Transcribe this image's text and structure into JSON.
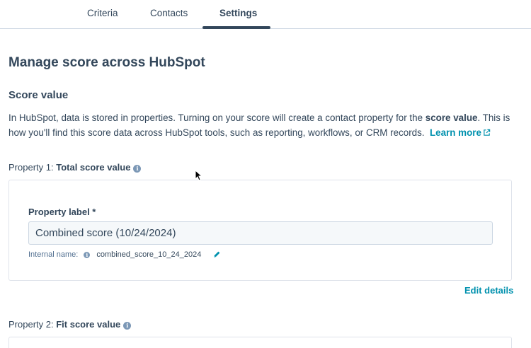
{
  "tabs": [
    {
      "label": "Criteria",
      "active": false
    },
    {
      "label": "Contacts",
      "active": false
    },
    {
      "label": "Settings",
      "active": true
    }
  ],
  "page_title": "Manage score across HubSpot",
  "section": {
    "title": "Score value",
    "description_1": "In HubSpot, data is stored in properties. Turning on your score will create a contact property for the ",
    "description_bold": "score value",
    "description_2": ". This is how you'll find this score data across HubSpot tools, such as reporting, workflows, or CRM records.",
    "learn_more": "Learn more"
  },
  "property1": {
    "prefix": "Property 1:",
    "name": "Total score value",
    "field_label": "Property label *",
    "field_value": "Combined score (10/24/2024)",
    "internal_label": "Internal name:",
    "internal_value": "combined_score_10_24_2024",
    "edit_details": "Edit details"
  },
  "property2": {
    "prefix": "Property 2:",
    "name": "Fit score value"
  },
  "icons": {
    "info": "info-icon",
    "external": "external-link-icon",
    "edit": "pencil-icon"
  },
  "colors": {
    "text": "#33475b",
    "link": "#0091ae",
    "border": "#cbd6e2"
  }
}
